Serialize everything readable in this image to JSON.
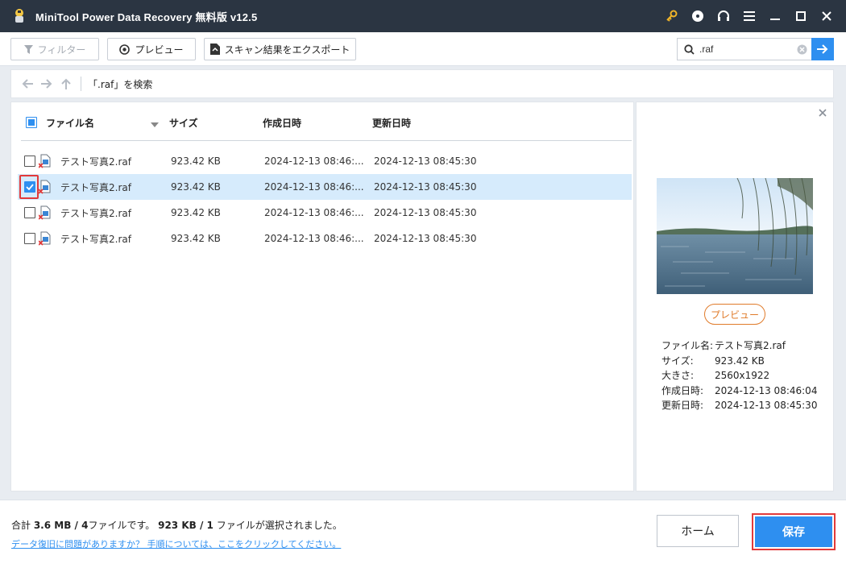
{
  "window": {
    "title": "MiniTool Power Data Recovery 無料版 v12.5",
    "icons": [
      "key-icon",
      "disc-icon",
      "headset-icon",
      "menu-icon",
      "minimize-icon",
      "maximize-icon",
      "close-icon"
    ]
  },
  "toolbar": {
    "filter_label": "フィルター",
    "preview_label": "プレビュー",
    "export_label": "スキャン結果をエクスポート",
    "search_value": ".raf"
  },
  "nav": {
    "path": "「.raf」を検索"
  },
  "table": {
    "headers": {
      "name": "ファイル名",
      "size": "サイズ",
      "created": "作成日時",
      "modified": "更新日時"
    },
    "rows": [
      {
        "name": "テスト写真2.raf",
        "size": "923.42 KB",
        "created": "2024-12-13 08:46:...",
        "modified": "2024-12-13 08:45:30",
        "checked": false
      },
      {
        "name": "テスト写真2.raf",
        "size": "923.42 KB",
        "created": "2024-12-13 08:46:...",
        "modified": "2024-12-13 08:45:30",
        "checked": true
      },
      {
        "name": "テスト写真2.raf",
        "size": "923.42 KB",
        "created": "2024-12-13 08:46:...",
        "modified": "2024-12-13 08:45:30",
        "checked": false
      },
      {
        "name": "テスト写真2.raf",
        "size": "923.42 KB",
        "created": "2024-12-13 08:46:...",
        "modified": "2024-12-13 08:45:30",
        "checked": false
      }
    ]
  },
  "preview": {
    "button_label": "プレビュー",
    "info": [
      {
        "key": "ファイル名:",
        "value": "テスト写真2.raf"
      },
      {
        "key": "サイズ:",
        "value": "923.42 KB"
      },
      {
        "key": "大きさ:",
        "value": "2560x1922"
      },
      {
        "key": "作成日時:",
        "value": "2024-12-13 08:46:04"
      },
      {
        "key": "更新日時:",
        "value": "2024-12-13 08:45:30"
      }
    ]
  },
  "footer": {
    "summary_prefix": "合計 ",
    "total_size": "3.6 MB",
    "summary_sep1": " / ",
    "total_files": "4",
    "summary_mid": "ファイルです。 ",
    "selected_size": "923 KB",
    "summary_sep2": " / ",
    "selected_files": "1",
    "summary_suffix": " ファイルが選択されました。",
    "help_link": "データ復旧に問題がありますか？ 手順については、ここをクリックしてください。",
    "home_label": "ホーム",
    "save_label": "保存"
  },
  "colors": {
    "accent": "#2e8ff0",
    "titlebar": "#2b3542",
    "highlight": "#e23a3a",
    "selected_row": "#d6ebfc",
    "preview_accent": "#e07b2a"
  }
}
